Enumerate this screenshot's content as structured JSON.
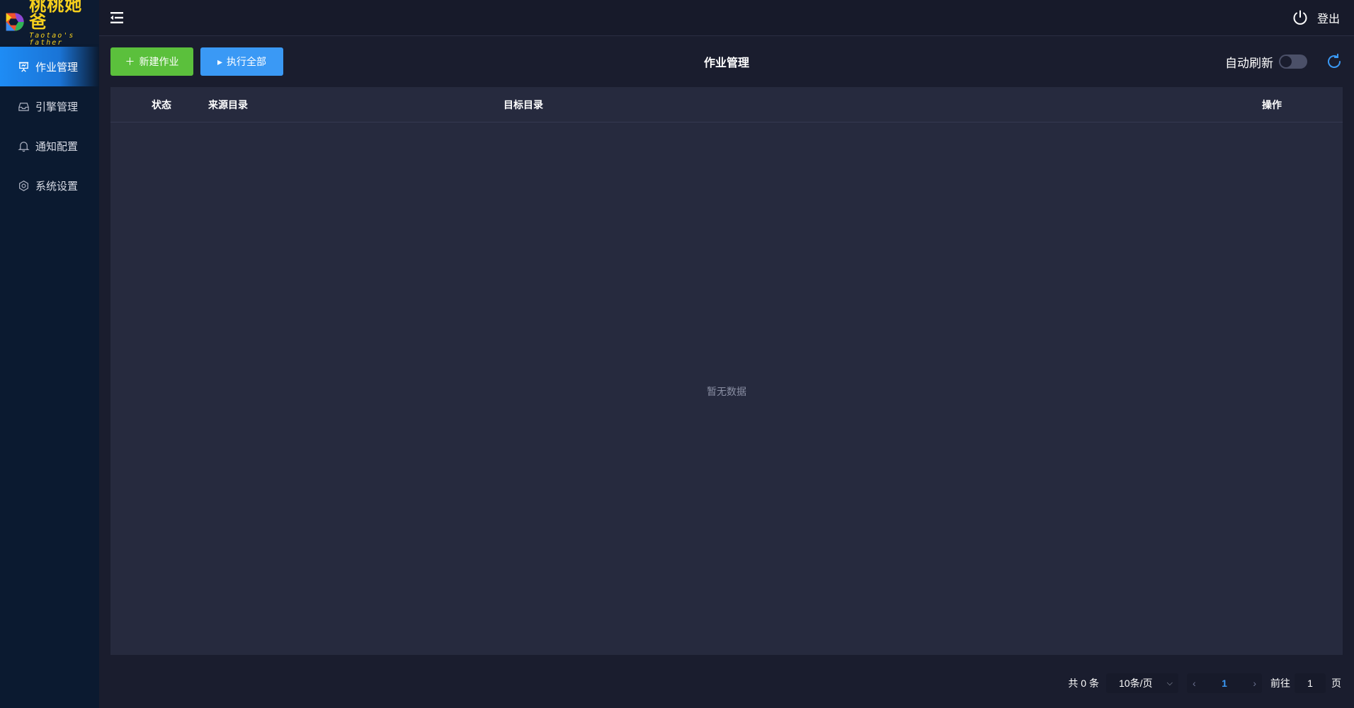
{
  "brand": {
    "title": "桃桃她爸",
    "subtitle": "Taotao's father"
  },
  "sidebar": {
    "items": [
      {
        "label": "作业管理",
        "icon": "presentation-board-icon",
        "active": true
      },
      {
        "label": "引擎管理",
        "icon": "inbox-tray-icon",
        "active": false
      },
      {
        "label": "通知配置",
        "icon": "bell-icon",
        "active": false
      },
      {
        "label": "系统设置",
        "icon": "gear-icon",
        "active": false
      }
    ]
  },
  "header": {
    "logout_label": "登出"
  },
  "toolbar": {
    "new_job_label": "新建作业",
    "run_all_label": "执行全部",
    "page_title": "作业管理",
    "auto_refresh_label": "自动刷新",
    "auto_refresh_on": false
  },
  "table": {
    "columns": [
      "状态",
      "来源目录",
      "目标目录",
      "操作"
    ],
    "rows": [],
    "empty_text": "暂无数据"
  },
  "pagination": {
    "total_text": "共 0 条",
    "page_size": "10条/页",
    "current_page": "1",
    "jump_prefix": "前往",
    "jump_value": "1",
    "jump_suffix": "页"
  },
  "colors": {
    "accent_blue": "#3a99f5",
    "accent_green": "#5bc03c",
    "brand_yellow": "#f5cf1d"
  }
}
